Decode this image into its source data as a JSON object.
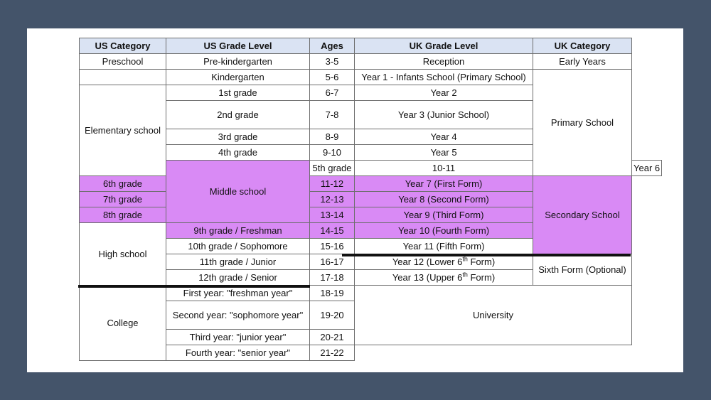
{
  "table": {
    "header": {
      "us_category": "US Category",
      "us_grade": "US Grade Level",
      "ages": "Ages",
      "uk_grade": "UK Grade Level",
      "uk_category": "UK Category"
    },
    "us_categories": {
      "preschool": "Preschool",
      "elementary": "Elementary school",
      "middle": "Middle school",
      "high": "High school",
      "college": "College"
    },
    "rows": [
      {
        "us_grade": "Pre-kindergarten",
        "ages": "3-5",
        "uk_grade": "Reception"
      },
      {
        "us_grade": "Kindergarten",
        "ages": "5-6",
        "uk_grade": "Year 1 - Infants School (Primary School)"
      },
      {
        "us_grade": "1st grade",
        "ages": "6-7",
        "uk_grade": "Year 2"
      },
      {
        "us_grade": "2nd grade",
        "ages": "7-8",
        "uk_grade": "Year 3 (Junior School)"
      },
      {
        "us_grade": "3rd grade",
        "ages": "8-9",
        "uk_grade": "Year 4"
      },
      {
        "us_grade": "4th grade",
        "ages": "9-10",
        "uk_grade": "Year 5"
      },
      {
        "us_grade": "5th grade",
        "ages": "10-11",
        "uk_grade": "Year 6"
      },
      {
        "us_grade": "6th grade",
        "ages": "11-12",
        "uk_grade": "Year 7 (First Form)"
      },
      {
        "us_grade": "7th grade",
        "ages": "12-13",
        "uk_grade": "Year 8 (Second Form)"
      },
      {
        "us_grade": "8th grade",
        "ages": "13-14",
        "uk_grade": "Year 9 (Third Form)"
      },
      {
        "us_grade": "9th grade / Freshman",
        "ages": "14-15",
        "uk_grade": "Year 10 (Fourth Form)"
      },
      {
        "us_grade": "10th grade / Sophomore",
        "ages": "15-16",
        "uk_grade": "Year 11 (Fifth Form)"
      },
      {
        "us_grade": "11th grade / Junior",
        "ages": "16-17",
        "uk_grade_pre": "Year 12 (Lower 6",
        "uk_grade_sup": "th",
        "uk_grade_post": " Form)"
      },
      {
        "us_grade": "12th grade / Senior",
        "ages": "17-18",
        "uk_grade_pre": "Year 13 (Upper 6",
        "uk_grade_sup": "th",
        "uk_grade_post": " Form)"
      },
      {
        "us_grade": "First year: \"freshman year\"",
        "ages": "18-19"
      },
      {
        "us_grade": "Second year: \"sophomore year\"",
        "ages": "19-20"
      },
      {
        "us_grade": "Third year: \"junior year\"",
        "ages": "20-21"
      },
      {
        "us_grade": "Fourth year: \"senior year\"",
        "ages": "21-22"
      }
    ],
    "uk_categories": {
      "early_years": "Early Years",
      "primary": "Primary School",
      "secondary": "Secondary School",
      "sixth_form": "Sixth Form (Optional)",
      "university": "University"
    },
    "highlight_color": "#d98af5",
    "header_color": "#dae3f3"
  }
}
